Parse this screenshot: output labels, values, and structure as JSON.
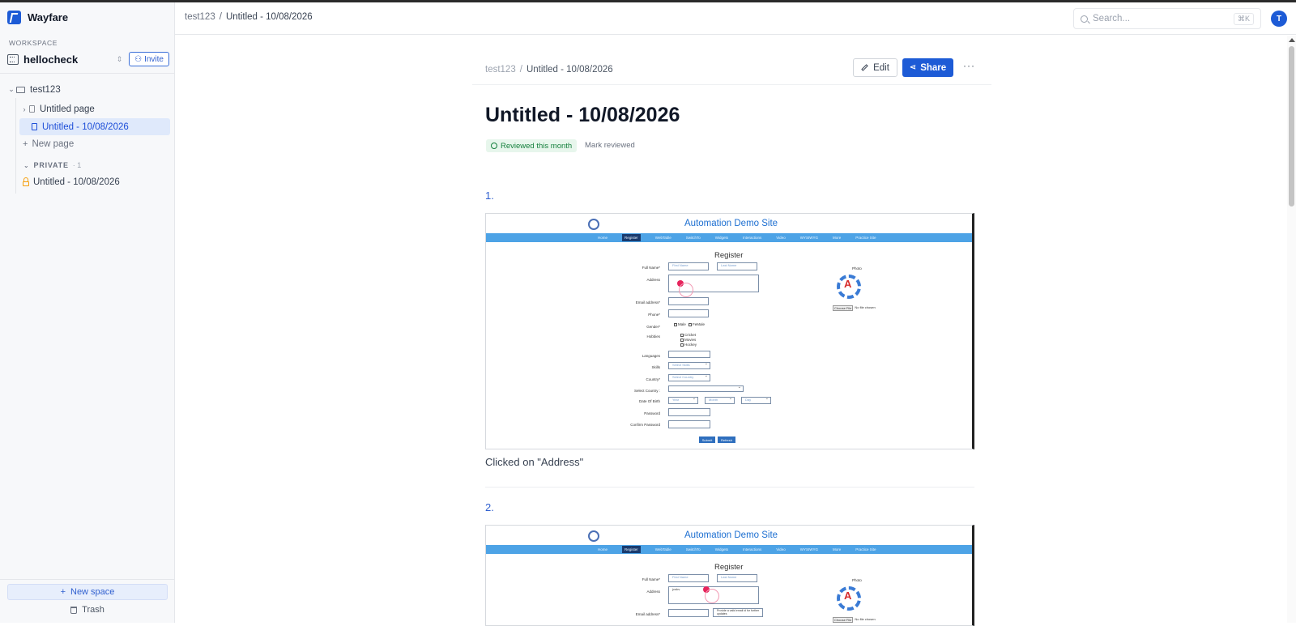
{
  "app": {
    "name": "Wayfare"
  },
  "sidebar": {
    "workspace_label": "WORKSPACE",
    "workspace_name": "hellocheck",
    "invite_label": "Invite",
    "tree": {
      "root": "test123",
      "items": [
        {
          "label": "Untitled page"
        },
        {
          "label": "Untitled - 10/08/2026"
        }
      ],
      "new_page": "New page"
    },
    "private": {
      "label": "PRIVATE",
      "count": "· 1",
      "items": [
        {
          "label": "Untitled - 10/08/2026"
        }
      ]
    },
    "new_space": "New space",
    "trash": "Trash"
  },
  "topbar": {
    "breadcrumb": {
      "root": "test123",
      "sep": "/",
      "current": "Untitled - 10/08/2026"
    },
    "search_placeholder": "Search...",
    "search_shortcut": "⌘K",
    "avatar_initial": "T"
  },
  "doc": {
    "breadcrumb": {
      "root": "test123",
      "sep": "/",
      "current": "Untitled - 10/08/2026"
    },
    "edit_label": "Edit",
    "share_label": "Share",
    "more_label": "···",
    "title": "Untitled - 10/08/2026",
    "reviewed_badge": "Reviewed this month",
    "mark_reviewed": "Mark reviewed",
    "steps": [
      {
        "number": "1.",
        "caption": "Clicked on \"Address\""
      },
      {
        "number": "2."
      }
    ]
  },
  "screenshot": {
    "site_title": "Automation Demo Site",
    "nav": [
      "Home",
      "Register",
      "WebTable",
      "SwitchTo",
      "Widgets",
      "Interactions",
      "Video",
      "WYSIWYG",
      "More",
      "Practice Site"
    ],
    "heading": "Register",
    "labels": {
      "full_name": "Full Name*",
      "address": "Address",
      "email": "Email address*",
      "phone": "Phone*",
      "gender": "Gender*",
      "hobbies": "Hobbies",
      "languages": "Languages",
      "skills": "Skills",
      "country": "Country*",
      "select_country": "Select Country :",
      "dob": "Date Of Birth",
      "password": "Password",
      "confirm_password": "Confirm Password",
      "photo": "Photo"
    },
    "placeholders": {
      "first_name": "First Name",
      "last_name": "Last Name",
      "skills": "Select Skills",
      "country": "Select Country",
      "year": "Year",
      "month": "Month",
      "day": "Day"
    },
    "address_value_2": "jvnbv",
    "email_note_2": "Provide a valid email id for further updates",
    "gender_options": [
      "Male",
      "FeMale"
    ],
    "hobbies_options": [
      "Cricket",
      "Movies",
      "Hockey"
    ],
    "file_button": "Choose File",
    "file_status": "No file chosen",
    "submit": "Submit",
    "refresh": "Refresh"
  }
}
